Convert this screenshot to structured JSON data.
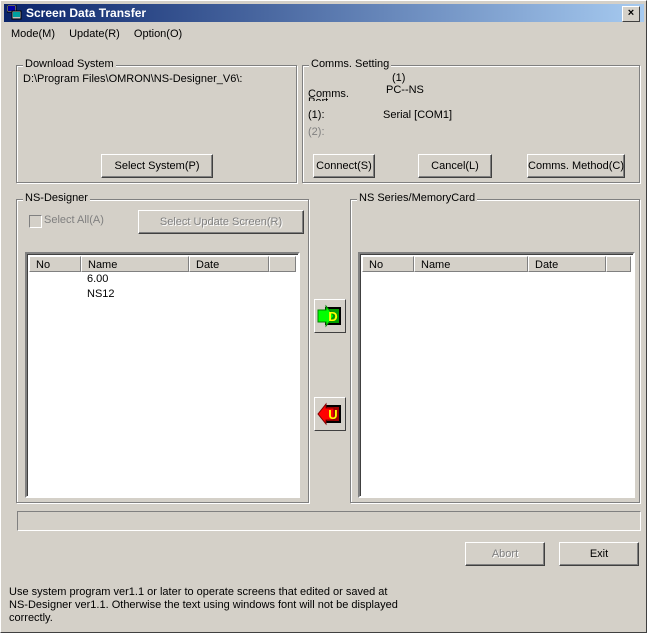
{
  "window": {
    "title": "Screen Data Transfer",
    "close": "×"
  },
  "menu": [
    "Mode(M)",
    "Update(R)",
    "Option(O)"
  ],
  "download_system": {
    "title": "Download System",
    "path": "D:\\Program Files\\OMRON\\NS-Designer_V6\\:",
    "select_button": "Select System(P)"
  },
  "comms": {
    "title": "Comms. Setting",
    "comms_label": "Comms.",
    "port_label": "Port",
    "index_header": "(1)",
    "comms_value": "PC--NS",
    "port1_label": "(1):",
    "port1_value": "Serial [COM1]",
    "port2_label": "(2):",
    "connect_button": "Connect(S)",
    "cancel_button": "Cancel(L)",
    "method_button": "Comms. Method(C)"
  },
  "ns_designer": {
    "title": "NS-Designer",
    "select_all": "Select All(A)",
    "select_update": "Select Update Screen(R)",
    "columns": [
      "No",
      "Name",
      "Date"
    ],
    "rows": [
      {
        "no": "",
        "name": "6.00",
        "date": ""
      },
      {
        "no": "",
        "name": "NS12",
        "date": ""
      }
    ]
  },
  "ns_series": {
    "title": "NS Series/MemoryCard",
    "columns": [
      "No",
      "Name",
      "Date"
    ]
  },
  "transfer": {
    "download_label": "D",
    "upload_label": "U"
  },
  "footer": {
    "abort_button": "Abort",
    "exit_button": "Exit",
    "note_line1": "Use system program ver1.1 or later to operate screens that edited or saved at",
    "note_line2": "NS-Designer ver1.1. Otherwise the text using windows font will not be displayed",
    "note_line3": "correctly."
  }
}
